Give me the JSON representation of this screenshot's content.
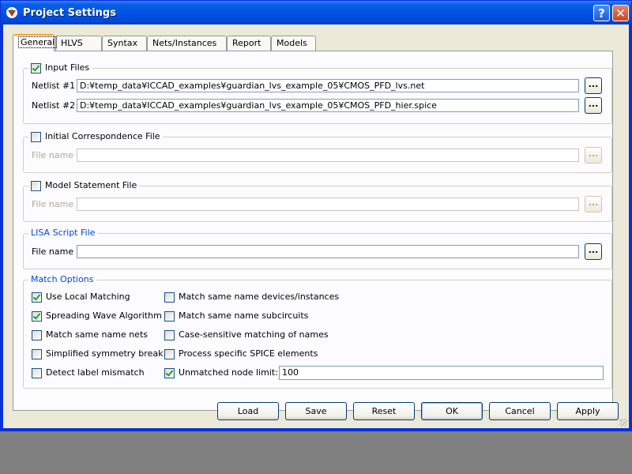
{
  "window": {
    "title": "Project Settings",
    "help_label": "?",
    "close_label": "✕",
    "icon": "app-logo-icon"
  },
  "tabs": [
    {
      "label": "General",
      "active": true
    },
    {
      "label": "HLVS"
    },
    {
      "label": "Syntax"
    },
    {
      "label": "Nets/Instances"
    },
    {
      "label": "Report"
    },
    {
      "label": "Models"
    }
  ],
  "input_files": {
    "legend": "Input Files",
    "checked": true,
    "netlist1_label": "Netlist #1",
    "netlist1_value": "D:¥temp_data¥ICCAD_examples¥guardian_lvs_example_05¥CMOS_PFD_lvs.net",
    "netlist2_label": "Netlist #2",
    "netlist2_value": "D:¥temp_data¥ICCAD_examples¥guardian_lvs_example_05¥CMOS_PFD_hier.spice",
    "browse_label": "..."
  },
  "initial_corr": {
    "legend": "Initial Correspondence File",
    "checked": false,
    "file_label": "File name",
    "value": "",
    "browse_label": "..."
  },
  "model_stmt": {
    "legend": "Model Statement File",
    "checked": false,
    "file_label": "File name",
    "value": "",
    "browse_label": "..."
  },
  "lisa": {
    "legend": "LISA Script File",
    "file_label": "File name",
    "value": "",
    "browse_label": "..."
  },
  "match": {
    "legend": "Match Options",
    "left": [
      {
        "label": "Use Local Matching",
        "checked": true
      },
      {
        "label": "Spreading Wave Algorithm",
        "checked": true
      },
      {
        "label": "Match same name nets",
        "checked": false
      },
      {
        "label": "Simplified symmetry break",
        "checked": false
      },
      {
        "label": "Detect label mismatch",
        "checked": false
      }
    ],
    "right": [
      {
        "label": "Match same name devices/instances",
        "checked": false
      },
      {
        "label": "Match same name subcircuits",
        "checked": false
      },
      {
        "label": "Case-sensitive matching of names",
        "checked": false
      },
      {
        "label": "Process specific SPICE elements",
        "checked": false
      },
      {
        "label": "Unmatched node limit:",
        "checked": true
      }
    ],
    "node_limit_value": "100"
  },
  "buttons": {
    "load": "Load",
    "save": "Save",
    "reset": "Reset",
    "ok": "OK",
    "cancel": "Cancel",
    "apply": "Apply"
  }
}
